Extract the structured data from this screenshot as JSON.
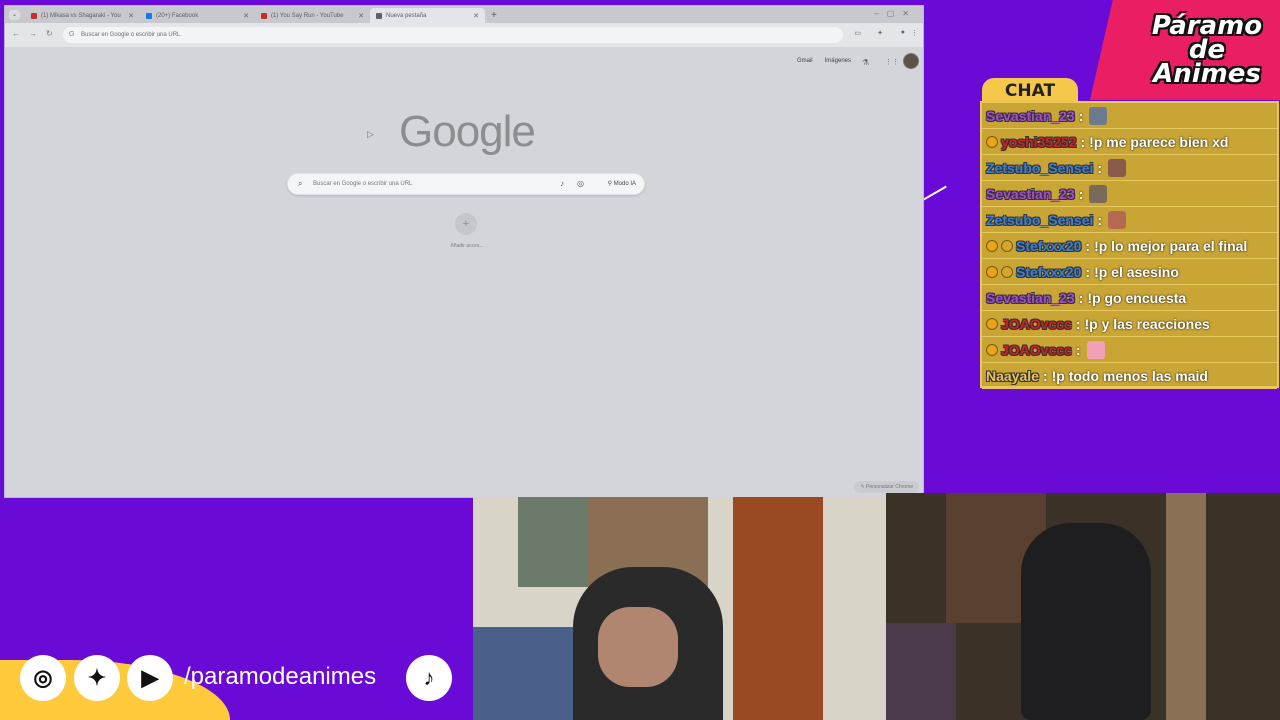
{
  "browser": {
    "tabs": [
      {
        "title": "(1) Mikasa vs Shagaraki - You",
        "color": "#c4302b",
        "active": false
      },
      {
        "title": "(20+) Facebook",
        "color": "#1877f2",
        "active": false
      },
      {
        "title": "(1) You Say Run - YouTube",
        "color": "#c4302b",
        "active": false
      },
      {
        "title": "Nueva pestaña",
        "color": "#5f6368",
        "active": true
      }
    ],
    "omnibox_placeholder": "Buscar en Google o escribir una URL",
    "top_links": {
      "gmail": "Gmail",
      "images": "Imágenes"
    },
    "logo_text": "Google",
    "search_placeholder": "Buscar en Google o escribir una URL",
    "ai_mode_label": "Modo IA",
    "add_shortcut_label": "Añadir acces...",
    "customize_label": "Personalizar Chrome"
  },
  "overlay": {
    "logo_lines": [
      "Páramo",
      "de",
      "Animes"
    ],
    "chat_title": "CHAT",
    "social_handle": "/paramodeanimes",
    "colors": {
      "background": "#6a0ad6",
      "chat_bg": "#c9a536",
      "accent_pink": "#e91e63",
      "accent_yellow": "#ffc93c"
    }
  },
  "chat": {
    "messages": [
      {
        "badges": 0,
        "user": "Sevastian_23",
        "color": "#a64bd6",
        "text": "",
        "emote": "#6b7a8f"
      },
      {
        "badges": 1,
        "user": "yoshi35252",
        "color": "#d32020",
        "text": "!p me parece bien xd",
        "emote": ""
      },
      {
        "badges": 0,
        "user": "Zetsubo_Sensei",
        "color": "#3a7fd8",
        "text": "",
        "emote": "#8a5a4a"
      },
      {
        "badges": 0,
        "user": "Sevastian_23",
        "color": "#a64bd6",
        "text": "",
        "emote": "#7a6a5a"
      },
      {
        "badges": 0,
        "user": "Zetsubo_Sensei",
        "color": "#3a7fd8",
        "text": "",
        "emote": "#b46a50"
      },
      {
        "badges": 2,
        "user": "Stefxxx20",
        "color": "#3a7fd8",
        "text": "!p lo mejor para el final",
        "emote": ""
      },
      {
        "badges": 2,
        "user": "Stefxxx20",
        "color": "#3a7fd8",
        "text": "!p el asesino",
        "emote": ""
      },
      {
        "badges": 0,
        "user": "Sevastian_23",
        "color": "#a64bd6",
        "text": "!p go encuesta",
        "emote": ""
      },
      {
        "badges": 1,
        "user": "JOAOvccc",
        "color": "#d32020",
        "text": "!p y las reacciones",
        "emote": ""
      },
      {
        "badges": 1,
        "user": "JOAOvccc",
        "color": "#d32020",
        "text": "",
        "emote": "#f2a0b8"
      },
      {
        "badges": 0,
        "user": "Naayale",
        "color": "#e8c25a",
        "text": "!p todo menos las maid",
        "emote": ""
      }
    ]
  },
  "icons": {
    "instagram": "instagram-icon",
    "twitter": "twitter-icon",
    "youtube": "youtube-icon",
    "tiktok": "tiktok-icon"
  }
}
